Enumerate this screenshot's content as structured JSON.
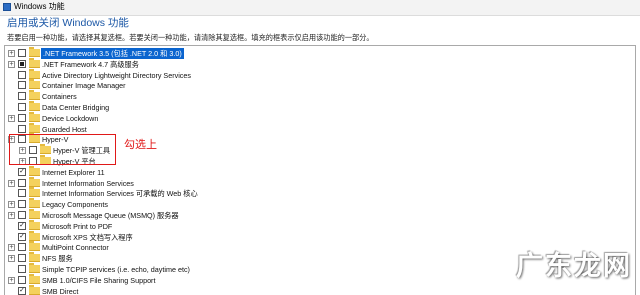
{
  "window": {
    "title": "Windows 功能"
  },
  "heading": "启用或关闭 Windows 功能",
  "description": "若要启用一种功能，请选择其复选框。若要关闭一种功能，请清除其复选框。填充的框表示仅启用该功能的一部分。",
  "features": [
    {
      "label": ".NET Framework 3.5 (包括 .NET 2.0 和 3.0)",
      "expandable": true,
      "state": "unchecked",
      "level": 0,
      "selected": true
    },
    {
      "label": ".NET Framework 4.7 高级服务",
      "expandable": true,
      "state": "partial",
      "level": 0,
      "selected": false
    },
    {
      "label": "Active Directory Lightweight Directory Services",
      "expandable": false,
      "state": "unchecked",
      "level": 0,
      "selected": false
    },
    {
      "label": "Container Image Manager",
      "expandable": false,
      "state": "unchecked",
      "level": 0,
      "selected": false
    },
    {
      "label": "Containers",
      "expandable": false,
      "state": "unchecked",
      "level": 0,
      "selected": false
    },
    {
      "label": "Data Center Bridging",
      "expandable": false,
      "state": "unchecked",
      "level": 0,
      "selected": false
    },
    {
      "label": "Device Lockdown",
      "expandable": true,
      "state": "unchecked",
      "level": 0,
      "selected": false
    },
    {
      "label": "Guarded Host",
      "expandable": false,
      "state": "unchecked",
      "level": 0,
      "selected": false
    },
    {
      "label": "Hyper-V",
      "expandable": true,
      "state": "unchecked",
      "level": 0,
      "selected": false
    },
    {
      "label": "Hyper-V 管理工具",
      "expandable": true,
      "state": "unchecked",
      "level": 1,
      "selected": false
    },
    {
      "label": "Hyper-V 平台",
      "expandable": true,
      "state": "unchecked",
      "level": 1,
      "selected": false
    },
    {
      "label": "Internet Explorer 11",
      "expandable": false,
      "state": "checked",
      "level": 0,
      "selected": false
    },
    {
      "label": "Internet Information Services",
      "expandable": true,
      "state": "unchecked",
      "level": 0,
      "selected": false
    },
    {
      "label": "Internet Information Services 可承载的 Web 核心",
      "expandable": false,
      "state": "unchecked",
      "level": 0,
      "selected": false
    },
    {
      "label": "Legacy Components",
      "expandable": true,
      "state": "unchecked",
      "level": 0,
      "selected": false
    },
    {
      "label": "Microsoft Message Queue (MSMQ) 服务器",
      "expandable": true,
      "state": "unchecked",
      "level": 0,
      "selected": false
    },
    {
      "label": "Microsoft Print to PDF",
      "expandable": false,
      "state": "checked",
      "level": 0,
      "selected": false
    },
    {
      "label": "Microsoft XPS 文档写入程序",
      "expandable": false,
      "state": "checked",
      "level": 0,
      "selected": false
    },
    {
      "label": "MultiPoint Connector",
      "expandable": true,
      "state": "unchecked",
      "level": 0,
      "selected": false
    },
    {
      "label": "NFS 服务",
      "expandable": true,
      "state": "unchecked",
      "level": 0,
      "selected": false
    },
    {
      "label": "Simple TCPIP services (i.e. echo, daytime etc)",
      "expandable": false,
      "state": "unchecked",
      "level": 0,
      "selected": false
    },
    {
      "label": "SMB 1.0/CIFS File Sharing Support",
      "expandable": true,
      "state": "unchecked",
      "level": 0,
      "selected": false
    },
    {
      "label": "SMB Direct",
      "expandable": false,
      "state": "checked",
      "level": 0,
      "selected": false
    }
  ],
  "annotation": "勾选上",
  "watermark": "广东龙网",
  "colors": {
    "heading": "#1b57a6",
    "selection": "#0a64cf",
    "annotation": "#e01818",
    "folder": "#f4d15d"
  }
}
